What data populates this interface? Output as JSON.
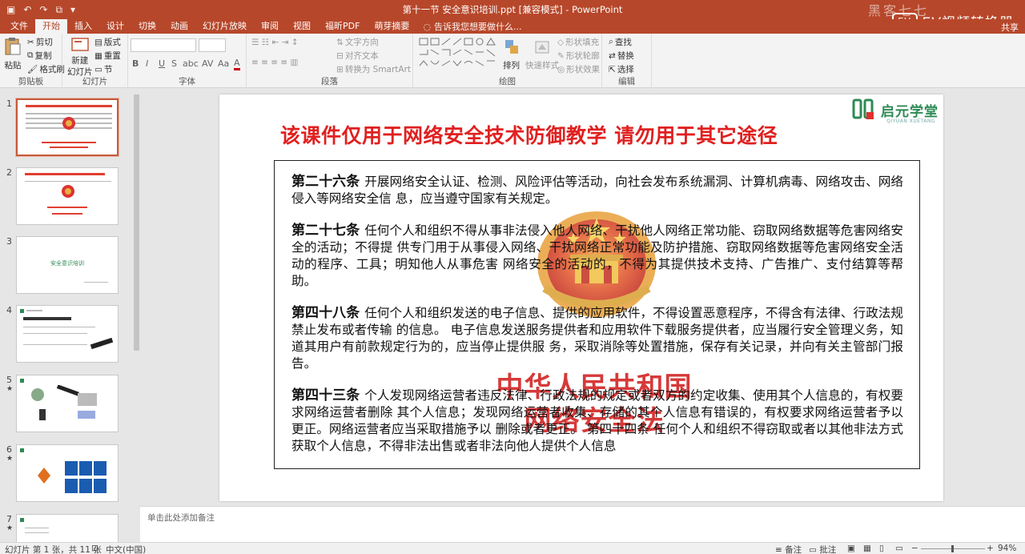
{
  "app": {
    "document_title": "第十一节 安全意识培训.ppt [兼容模式] - PowerPoint",
    "overlay_badge": "EV视频转换器",
    "overlay_logo": "EV",
    "watermark_text": "黑客七七",
    "share_label": "共享"
  },
  "tabs": [
    {
      "label": "文件",
      "active": false
    },
    {
      "label": "开始",
      "active": true
    },
    {
      "label": "插入",
      "active": false
    },
    {
      "label": "设计",
      "active": false
    },
    {
      "label": "切换",
      "active": false
    },
    {
      "label": "动画",
      "active": false
    },
    {
      "label": "幻灯片放映",
      "active": false
    },
    {
      "label": "审阅",
      "active": false
    },
    {
      "label": "视图",
      "active": false
    },
    {
      "label": "福昕PDF",
      "active": false
    },
    {
      "label": "萌芽摘要",
      "active": false
    }
  ],
  "tell_me": "告诉我您想要做什么...",
  "ribbon": {
    "clipboard": {
      "paste": "粘贴",
      "cut": "剪切",
      "copy": "复制",
      "format_painter": "格式刷",
      "label": "剪贴板"
    },
    "slides": {
      "new_slide": "新建",
      "new_slide2": "幻灯片",
      "layout": "版式",
      "reset": "重置",
      "section": "节",
      "label": "幻灯片"
    },
    "font": {
      "label": "字体",
      "bold": "B",
      "italic": "I",
      "underline": "U",
      "strike": "S",
      "shadow": "abc",
      "spacing": "AV",
      "case": "Aa",
      "color": "A"
    },
    "paragraph": {
      "text_direction": "文字方向",
      "align_text": "对齐文本",
      "smartart": "转换为 SmartArt",
      "label": "段落"
    },
    "drawing": {
      "arrange": "排列",
      "quick_styles": "快速样式",
      "shape_fill": "形状填充",
      "shape_outline": "形状轮廓",
      "shape_effects": "形状效果",
      "label": "绘图"
    },
    "editing": {
      "find": "查找",
      "replace": "替换",
      "select": "选择",
      "label": "编辑"
    }
  },
  "thumbnails": [
    {
      "num": "1",
      "star": "",
      "selected": true
    },
    {
      "num": "2",
      "star": "",
      "selected": false
    },
    {
      "num": "3",
      "star": "",
      "selected": false,
      "caption": "安全意识培训"
    },
    {
      "num": "4",
      "star": "",
      "selected": false
    },
    {
      "num": "5",
      "star": "★",
      "selected": false
    },
    {
      "num": "6",
      "star": "★",
      "selected": false
    },
    {
      "num": "7",
      "star": "★",
      "selected": false
    }
  ],
  "slide": {
    "banner": "该课件仅用于网络安全技术防御教学   请勿用于其它途径",
    "brand_name": "启元学堂",
    "brand_sub": "QIYUAN XUETANG",
    "law_title_line1": "中华人民共和国",
    "law_title_line2": "网络安全法",
    "articles": [
      {
        "heading": "第二十六条",
        "text": "开展网络安全认证、检测、风险评估等活动，向社会发布系统漏洞、计算机病毒、网络攻击、网络侵入等网络安全信 息，应当遵守国家有关规定。"
      },
      {
        "heading": "第二十七条",
        "text": "任何个人和组织不得从事非法侵入他人网络、干扰他人网络正常功能、窃取网络数据等危害网络安全的活动；不得提 供专门用于从事侵入网络、干扰网络正常功能及防护措施、窃取网络数据等危害网络安全活动的程序、工具；明知他人从事危害 网络安全的活动的，不得为其提供技术支持、广告推广、支付结算等帮助。"
      },
      {
        "heading": "第四十八条",
        "text": "任何个人和组织发送的电子信息、提供的应用软件，不得设置恶意程序，不得含有法律、行政法规禁止发布或者传输 的信息。 电子信息发送服务提供者和应用软件下载服务提供者，应当履行安全管理义务，知道其用户有前款规定行为的，应当停止提供服 务，采取消除等处置措施，保存有关记录，并向有关主管部门报告。"
      },
      {
        "heading": "第四十三条",
        "text": "个人发现网络运营者违反法律、行政法规的规定或者双方的约定收集、使用其个人信息的，有权要求网络运营者删除 其个人信息；发现网络运营者收集、存储的其个人信息有错误的，有权要求网络运营者予以更正。网络运营者应当采取措施予以 删除或者更正。 第四十四条  任何个人和组织不得窃取或者以其他非法方式获取个人信息，不得非法出售或者非法向他人提供个人信息"
      }
    ]
  },
  "notes_placeholder": "单击此处添加备注",
  "status": {
    "slide_count": "幻灯片 第 1 张，共 11 张",
    "language": "中文(中国)",
    "notes": "备注",
    "comments": "批注",
    "zoom": "94%"
  },
  "colors": {
    "accent": "#b7472a",
    "banner_red": "#e02020",
    "brand_green": "#2d8a55"
  }
}
